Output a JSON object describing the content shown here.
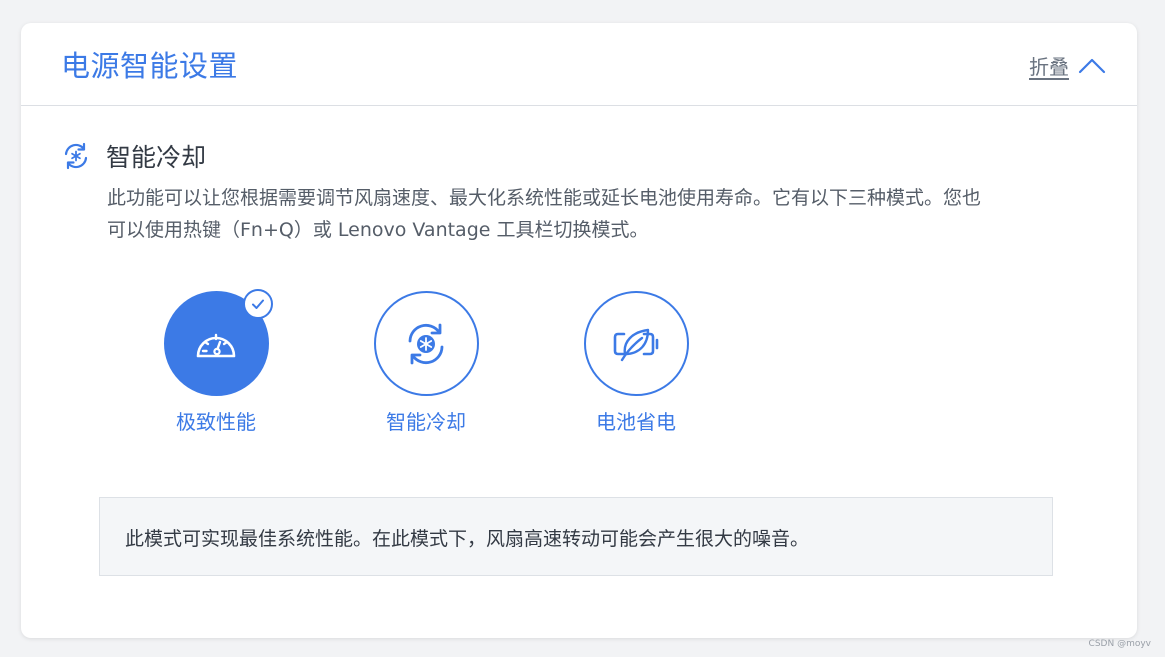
{
  "header": {
    "title": "电源智能设置",
    "collapse_label": "折叠"
  },
  "section": {
    "title": "智能冷却",
    "description": "此功能可以让您根据需要调节风扇速度、最大化系统性能或延长电池使用寿命。它有以下三种模式。您也可以使用热键（Fn+Q）或 Lenovo Vantage 工具栏切换模式。"
  },
  "modes": [
    {
      "label": "极致性能",
      "icon": "speedometer-icon",
      "selected": true
    },
    {
      "label": "智能冷却",
      "icon": "cooling-cycle-icon",
      "selected": false
    },
    {
      "label": "电池省电",
      "icon": "battery-leaf-icon",
      "selected": false
    }
  ],
  "info": {
    "text": "此模式可实现最佳系统性能。在此模式下，风扇高速转动可能会产生很大的噪音。"
  },
  "watermark": "CSDN @moyv",
  "colors": {
    "accent": "#3c7ae6",
    "background": "#f2f3f5",
    "card": "#ffffff",
    "info_bg": "#f4f6f8"
  }
}
